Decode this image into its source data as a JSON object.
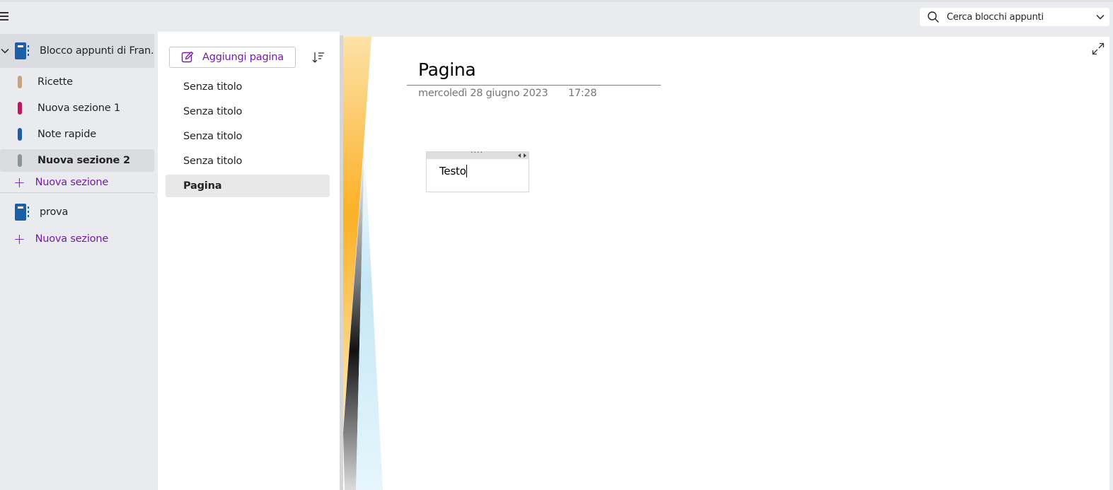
{
  "search": {
    "placeholder": "Cerca blocchi appunti"
  },
  "notebooks": [
    {
      "label": "Blocco appunti di Fran...",
      "color": "#1c5ea8",
      "sections": [
        {
          "label": "Ricette",
          "color": "#c9a27e"
        },
        {
          "label": "Nuova sezione 1",
          "color": "#c4155b"
        },
        {
          "label": "Note rapide",
          "color": "#1c5ea8"
        },
        {
          "label": "Nuova sezione 2",
          "color": "#8a9597"
        }
      ],
      "add_section_label": "Nuova sezione"
    },
    {
      "label": "prova",
      "color": "#1c5ea8",
      "add_section_label": "Nuova sezione"
    }
  ],
  "pages_pane": {
    "add_page_label": "Aggiungi pagina",
    "pages": [
      {
        "label": "Senza titolo"
      },
      {
        "label": "Senza titolo"
      },
      {
        "label": "Senza titolo"
      },
      {
        "label": "Senza titolo"
      },
      {
        "label": "Pagina"
      }
    ]
  },
  "page": {
    "title": "Pagina",
    "date": "mercoledì 28 giugno 2023",
    "time": "17:28",
    "note_text": "Testo"
  },
  "colors": {
    "accent": "#7719aa",
    "sidebar_bg": "#e9ebee",
    "selected_bg": "#dadcdf"
  }
}
